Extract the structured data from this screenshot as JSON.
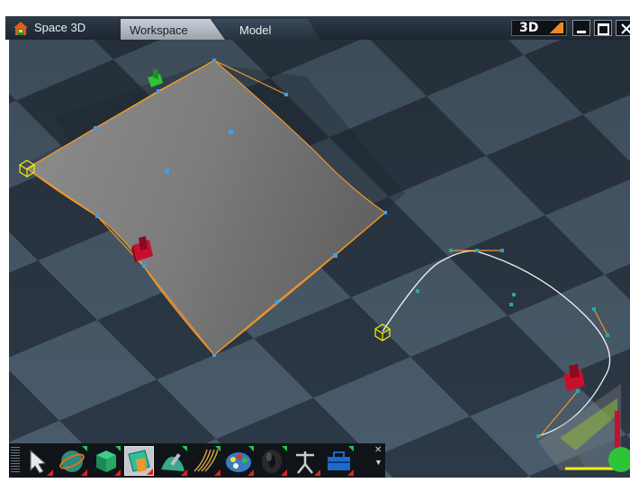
{
  "app": {
    "title": "Space 3D"
  },
  "tabs": [
    {
      "label": "Workspace",
      "active": true
    },
    {
      "label": "Model",
      "active": false
    }
  ],
  "window_controls": {
    "view_mode_label": "3D"
  },
  "toolbar": {
    "tools": [
      {
        "name": "select-arrow",
        "selected": false
      },
      {
        "name": "sphere-primitive",
        "selected": false
      },
      {
        "name": "cube-primitive",
        "selected": false
      },
      {
        "name": "surface-patch",
        "selected": true
      },
      {
        "name": "sculpt-surface",
        "selected": false
      },
      {
        "name": "curve-strands",
        "selected": false
      },
      {
        "name": "material-palette",
        "selected": false
      },
      {
        "name": "torus-primitive",
        "selected": false
      },
      {
        "name": "figure-model",
        "selected": false
      },
      {
        "name": "toolbox",
        "selected": false
      }
    ]
  },
  "colors": {
    "window_bg": "#ffffff",
    "titlebar": "#1d2530",
    "floor_light": "#4a5c6c",
    "floor_dark": "#2c3946",
    "patch_fill": "#808080",
    "control_line": "#f0962a",
    "control_point": "#3aa0f0",
    "curve": "#f2f2f2",
    "curve_point": "#2aa7a0",
    "gizmo_red": "#c8102e",
    "gizmo_green": "#2ec438",
    "gizmo_yellow": "#f4f000",
    "accent": "#f08a24"
  }
}
